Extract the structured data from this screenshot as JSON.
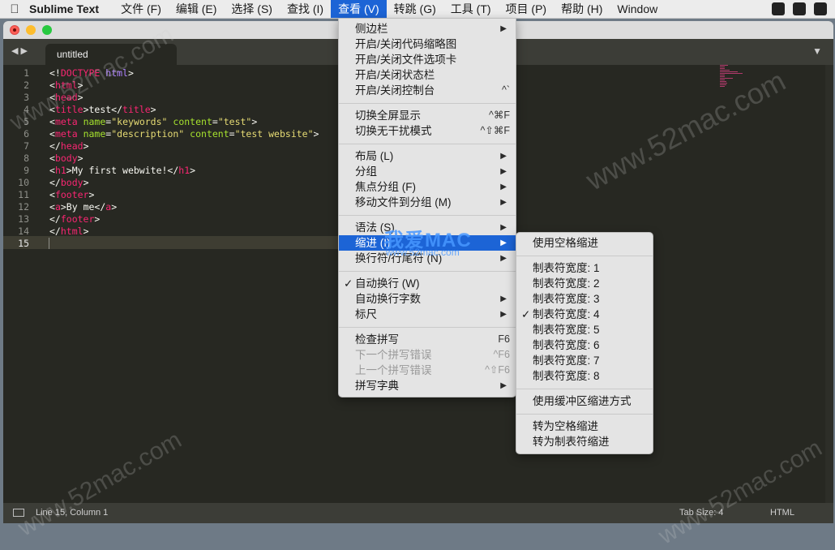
{
  "menubar": {
    "app_name": "Sublime Text",
    "items": [
      {
        "label": "文件 (F)"
      },
      {
        "label": "编辑 (E)"
      },
      {
        "label": "选择 (S)"
      },
      {
        "label": "查找 (I)"
      },
      {
        "label": "查看 (V)",
        "active": true
      },
      {
        "label": "转跳 (G)"
      },
      {
        "label": "工具 (T)"
      },
      {
        "label": "项目 (P)"
      },
      {
        "label": "帮助 (H)"
      },
      {
        "label": "Window"
      }
    ]
  },
  "tabs": [
    {
      "label": "untitled",
      "active": true
    }
  ],
  "editor": {
    "current_line": 15,
    "line_numbers": [
      "1",
      "2",
      "3",
      "4",
      "5",
      "6",
      "7",
      "8",
      "9",
      "10",
      "11",
      "12",
      "13",
      "14",
      "15"
    ],
    "lines": [
      [
        {
          "t": "<!",
          "c": ""
        },
        {
          "t": "DOCTYPE",
          "c": "tg"
        },
        {
          "t": " ",
          "c": ""
        },
        {
          "t": "html",
          "c": "dt"
        },
        {
          "t": ">",
          "c": ""
        }
      ],
      [
        {
          "t": "<",
          "c": ""
        },
        {
          "t": "html",
          "c": "tg"
        },
        {
          "t": ">",
          "c": ""
        }
      ],
      [
        {
          "t": "<",
          "c": ""
        },
        {
          "t": "head",
          "c": "tg"
        },
        {
          "t": ">",
          "c": ""
        }
      ],
      [
        {
          "t": "<",
          "c": ""
        },
        {
          "t": "title",
          "c": "tg"
        },
        {
          "t": ">test</",
          "c": ""
        },
        {
          "t": "title",
          "c": "tg"
        },
        {
          "t": ">",
          "c": ""
        }
      ],
      [
        {
          "t": "<",
          "c": ""
        },
        {
          "t": "meta",
          "c": "tg"
        },
        {
          "t": " ",
          "c": ""
        },
        {
          "t": "name",
          "c": "at"
        },
        {
          "t": "=",
          "c": ""
        },
        {
          "t": "\"keywords\"",
          "c": "st"
        },
        {
          "t": " ",
          "c": ""
        },
        {
          "t": "content",
          "c": "at"
        },
        {
          "t": "=",
          "c": ""
        },
        {
          "t": "\"test\"",
          "c": "st"
        },
        {
          "t": ">",
          "c": ""
        }
      ],
      [
        {
          "t": "<",
          "c": ""
        },
        {
          "t": "meta",
          "c": "tg"
        },
        {
          "t": " ",
          "c": ""
        },
        {
          "t": "name",
          "c": "at"
        },
        {
          "t": "=",
          "c": ""
        },
        {
          "t": "\"description\"",
          "c": "st"
        },
        {
          "t": " ",
          "c": ""
        },
        {
          "t": "content",
          "c": "at"
        },
        {
          "t": "=",
          "c": ""
        },
        {
          "t": "\"test website\"",
          "c": "st"
        },
        {
          "t": ">",
          "c": ""
        }
      ],
      [
        {
          "t": "</",
          "c": ""
        },
        {
          "t": "head",
          "c": "tg"
        },
        {
          "t": ">",
          "c": ""
        }
      ],
      [
        {
          "t": "<",
          "c": ""
        },
        {
          "t": "body",
          "c": "tg"
        },
        {
          "t": ">",
          "c": ""
        }
      ],
      [
        {
          "t": "<",
          "c": ""
        },
        {
          "t": "h1",
          "c": "tg"
        },
        {
          "t": ">My first webwite!</",
          "c": ""
        },
        {
          "t": "h1",
          "c": "tg"
        },
        {
          "t": ">",
          "c": ""
        }
      ],
      [
        {
          "t": "</",
          "c": ""
        },
        {
          "t": "body",
          "c": "tg"
        },
        {
          "t": ">",
          "c": ""
        }
      ],
      [
        {
          "t": "<",
          "c": ""
        },
        {
          "t": "footer",
          "c": "tg"
        },
        {
          "t": ">",
          "c": ""
        }
      ],
      [
        {
          "t": "<",
          "c": ""
        },
        {
          "t": "a",
          "c": "tg"
        },
        {
          "t": ">By me</",
          "c": ""
        },
        {
          "t": "a",
          "c": "tg"
        },
        {
          "t": ">",
          "c": ""
        }
      ],
      [
        {
          "t": "</",
          "c": ""
        },
        {
          "t": "footer",
          "c": "tg"
        },
        {
          "t": ">",
          "c": ""
        }
      ],
      [
        {
          "t": "</",
          "c": ""
        },
        {
          "t": "html",
          "c": "tg"
        },
        {
          "t": ">",
          "c": ""
        }
      ],
      []
    ]
  },
  "view_menu": {
    "items": [
      {
        "label": "侧边栏",
        "submenu": true
      },
      {
        "label": "开启/关闭代码缩略图"
      },
      {
        "label": "开启/关闭文件选项卡"
      },
      {
        "label": "开启/关闭状态栏"
      },
      {
        "label": "开启/关闭控制台",
        "shortcut": "^`"
      },
      {
        "separator": true
      },
      {
        "label": "切换全屏显示",
        "shortcut": "^⌘F"
      },
      {
        "label": "切换无干扰模式",
        "shortcut": "^⇧⌘F"
      },
      {
        "separator": true
      },
      {
        "label": "布局 (L)",
        "submenu": true
      },
      {
        "label": "分组",
        "submenu": true
      },
      {
        "label": "焦点分组 (F)",
        "submenu": true
      },
      {
        "label": "移动文件到分组 (M)",
        "submenu": true
      },
      {
        "separator": true
      },
      {
        "label": "语法 (S)",
        "submenu": true
      },
      {
        "label": "缩进 (I)",
        "submenu": true,
        "selected": true
      },
      {
        "label": "换行符/行尾符 (N)",
        "submenu": true
      },
      {
        "separator": true
      },
      {
        "label": "自动换行 (W)",
        "checked": true
      },
      {
        "label": "自动换行字数",
        "submenu": true
      },
      {
        "label": "标尺",
        "submenu": true
      },
      {
        "separator": true
      },
      {
        "label": "检查拼写",
        "shortcut": "F6"
      },
      {
        "label": "下一个拼写错误",
        "shortcut": "^F6",
        "disabled": true
      },
      {
        "label": "上一个拼写错误",
        "shortcut": "^⇧F6",
        "disabled": true
      },
      {
        "label": "拼写字典",
        "submenu": true
      }
    ]
  },
  "indent_menu": {
    "items": [
      {
        "label": "使用空格缩进"
      },
      {
        "separator": true
      },
      {
        "label": "制表符宽度: 1"
      },
      {
        "label": "制表符宽度: 2"
      },
      {
        "label": "制表符宽度: 3"
      },
      {
        "label": "制表符宽度: 4",
        "checked": true
      },
      {
        "label": "制表符宽度: 5"
      },
      {
        "label": "制表符宽度: 6"
      },
      {
        "label": "制表符宽度: 7"
      },
      {
        "label": "制表符宽度: 8"
      },
      {
        "separator": true
      },
      {
        "label": "使用缓冲区缩进方式"
      },
      {
        "separator": true
      },
      {
        "label": "转为空格缩进"
      },
      {
        "label": "转为制表符缩进"
      }
    ]
  },
  "statusbar": {
    "position": "Line 15, Column 1",
    "tab_size": "Tab Size: 4",
    "syntax": "HTML"
  },
  "watermarks": {
    "site": "www.52mac.com",
    "logo": "我爱MAC",
    "logo_sub": "www.52mac.com"
  },
  "colors": {
    "editor_bg": "#272822",
    "tag": "#f92672",
    "attribute": "#a6e22e",
    "string": "#e6db74",
    "menu_highlight": "#1c64d6"
  }
}
